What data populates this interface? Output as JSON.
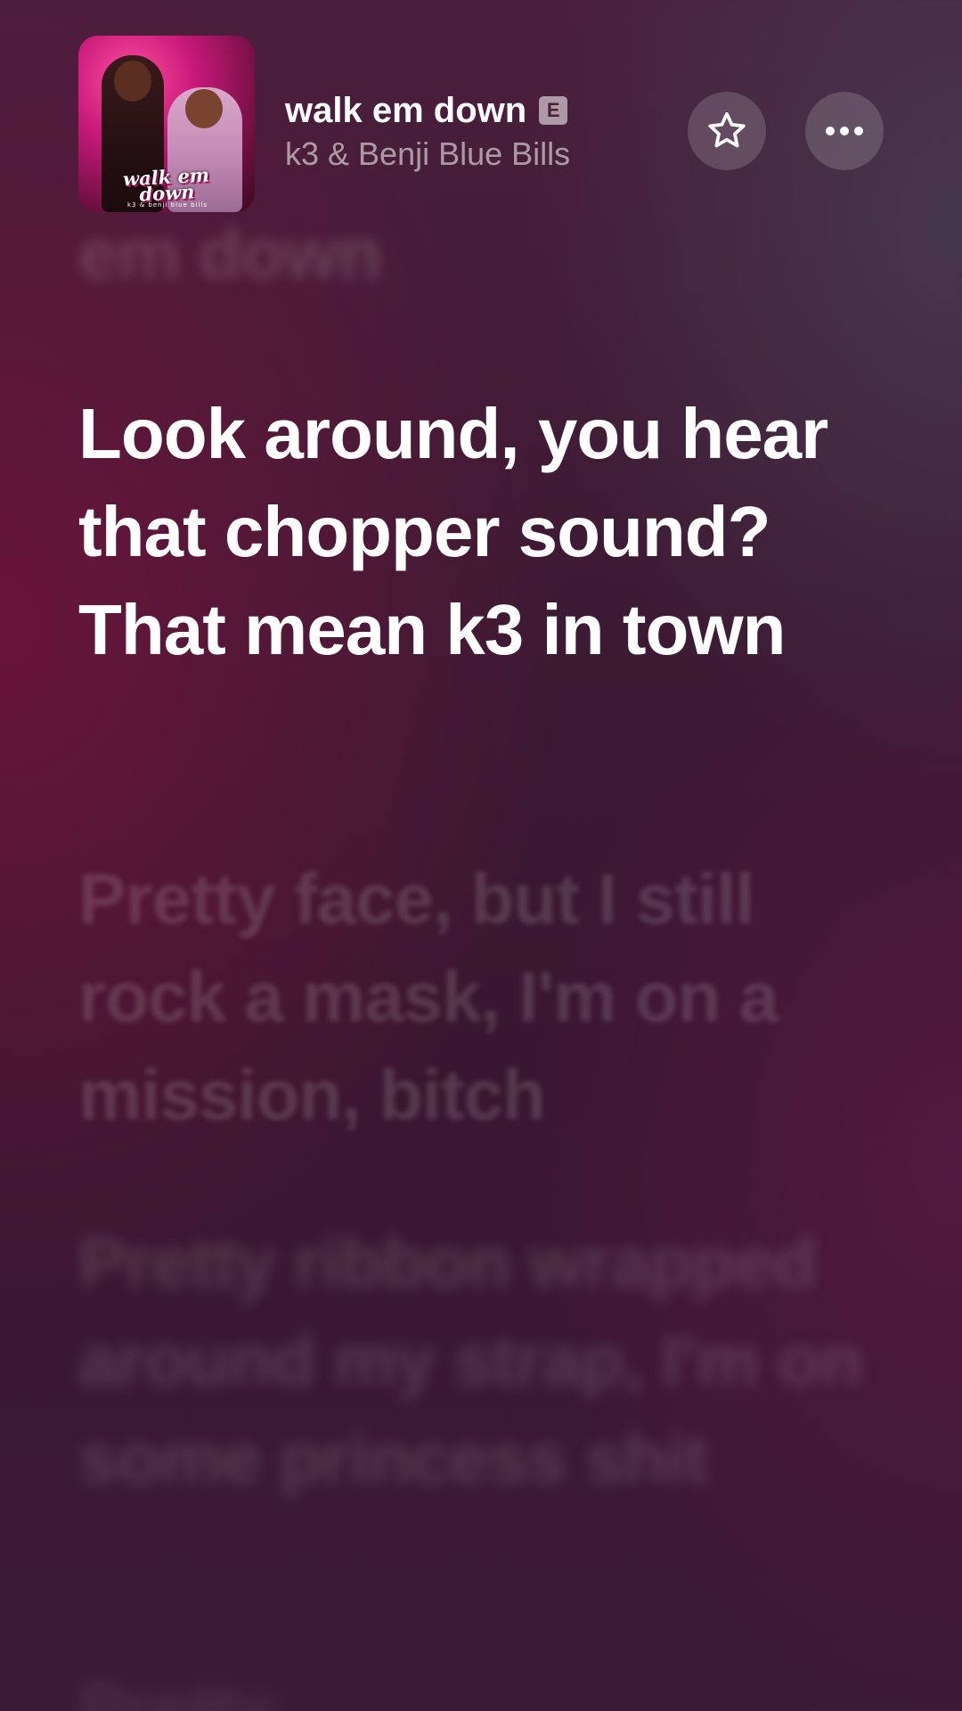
{
  "now_playing": {
    "title": "walk em down",
    "explicit_badge": "E",
    "artist": "k3 & Benji Blue Bills",
    "artwork": {
      "title_text": "walk em down",
      "subtitle_text": "k3 & benji blue bills"
    }
  },
  "actions": {
    "favorite_icon": "star-icon",
    "more_icon": "ellipsis-icon"
  },
  "lyrics": {
    "previous": "em down",
    "current": "Look around, you hear that chopper sound? That mean k3 in town",
    "next": [
      "Pretty face, but I still rock a mask, I'm on a mission, bitch",
      "Pretty ribbon wrapped around my strap, I'm on some princess shit",
      "Pretty"
    ]
  },
  "colors": {
    "background_top": "#4a1f3c",
    "background_bottom": "#3b1a34",
    "accent": "#ff4fa0",
    "text_primary": "#ffffff"
  }
}
